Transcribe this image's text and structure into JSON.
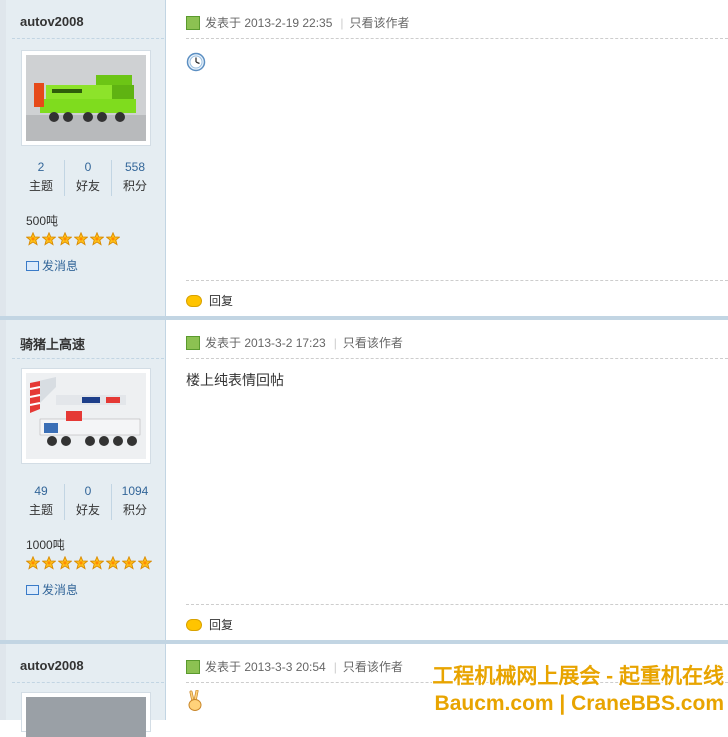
{
  "posts": [
    {
      "author": "autov2008",
      "stats": [
        {
          "value": "2",
          "label": "主题"
        },
        {
          "value": "0",
          "label": "好友"
        },
        {
          "value": "558",
          "label": "积分"
        }
      ],
      "rank": "500吨",
      "star_count": 6,
      "pm_label": "发消息",
      "posted": "发表于 2013-2-19 22:35",
      "only_author": "只看该作者",
      "content_icon": "clock-emoticon-icon",
      "content_text": "",
      "reply_label": "回复"
    },
    {
      "author": "骑猪上高速",
      "stats": [
        {
          "value": "49",
          "label": "主题"
        },
        {
          "value": "0",
          "label": "好友"
        },
        {
          "value": "1094",
          "label": "积分"
        }
      ],
      "rank": "1000吨",
      "star_count": 8,
      "pm_label": "发消息",
      "posted": "发表于 2013-3-2 17:23",
      "only_author": "只看该作者",
      "content_text": "楼上纯表情回帖",
      "reply_label": "回复"
    },
    {
      "author": "autov2008",
      "posted": "发表于 2013-3-3 20:54",
      "only_author": "只看该作者",
      "content_icon": "victory-hand-emoticon-icon"
    }
  ],
  "watermark": {
    "line1": "工程机械网上展会 - 起重机在线",
    "line2": "Baucm.com | CraneBBS.com"
  },
  "colors": {
    "sidebar_bg": "#e5edf2",
    "separator": "#c2d5e3",
    "link": "#336699",
    "watermark": "#e8a400"
  }
}
